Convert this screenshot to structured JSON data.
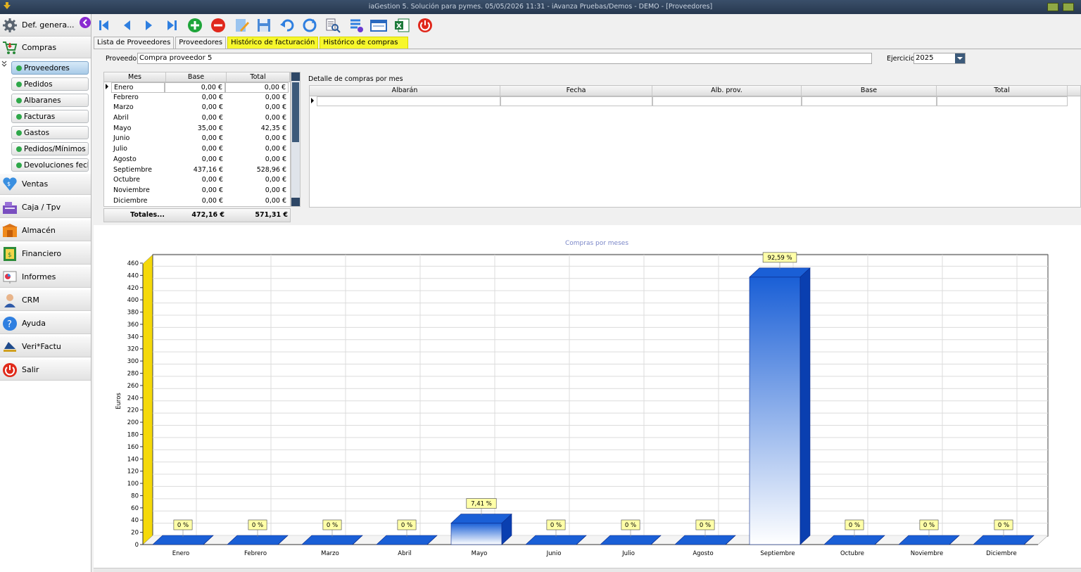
{
  "window": {
    "title": "iaGestion 5. Solución para pymes.  05/05/2026 11:31  -  iAvanza Pruebas/Demos - DEMO - [Proveedores]"
  },
  "sidebar": {
    "top_item": "Def. genera...",
    "sections": [
      {
        "label": "Compras",
        "icon": "cart-icon"
      },
      {
        "label": "Ventas",
        "icon": "sales-icon"
      },
      {
        "label": "Caja / Tpv",
        "icon": "cash-register-icon"
      },
      {
        "label": "Almacén",
        "icon": "warehouse-icon"
      },
      {
        "label": "Financiero",
        "icon": "finance-icon"
      },
      {
        "label": "Informes",
        "icon": "reports-icon"
      },
      {
        "label": "CRM",
        "icon": "crm-icon"
      },
      {
        "label": "Ayuda",
        "icon": "help-icon"
      },
      {
        "label": "Veri*Factu",
        "icon": "verifactu-icon"
      },
      {
        "label": "Salir",
        "icon": "power-icon"
      }
    ],
    "sub_items": [
      "Proveedores",
      "Pedidos",
      "Albaranes",
      "Facturas",
      "Gastos",
      "Pedidos/Mínimos",
      "Devoluciones fecha"
    ],
    "active_sub": "Proveedores"
  },
  "toolbar": {
    "buttons": [
      "first-record-icon",
      "previous-record-icon",
      "next-record-icon",
      "last-record-icon",
      "add-icon",
      "delete-icon",
      "edit-icon",
      "save-icon",
      "undo-icon",
      "refresh-icon",
      "search-icon",
      "list-icon",
      "card-icon",
      "excel-icon",
      "power-icon"
    ]
  },
  "tabs": [
    {
      "label": "Lista de Proveedores",
      "highlight": false
    },
    {
      "label": "Proveedores",
      "highlight": false
    },
    {
      "label": "Histórico de facturación",
      "highlight": true
    },
    {
      "label": "Histórico de compras",
      "highlight": true
    }
  ],
  "form": {
    "proveedor_label": "Proveedor",
    "proveedor_value": "Compra proveedor 5",
    "ejercicio_label": "Ejercicio",
    "ejercicio_value": "2025"
  },
  "month_grid": {
    "headers": [
      "Mes",
      "Base",
      "Total"
    ],
    "rows": [
      {
        "mes": "Enero",
        "base": "0,00 €",
        "total": "0,00 €"
      },
      {
        "mes": "Febrero",
        "base": "0,00 €",
        "total": "0,00 €"
      },
      {
        "mes": "Marzo",
        "base": "0,00 €",
        "total": "0,00 €"
      },
      {
        "mes": "Abril",
        "base": "0,00 €",
        "total": "0,00 €"
      },
      {
        "mes": "Mayo",
        "base": "35,00 €",
        "total": "42,35 €"
      },
      {
        "mes": "Junio",
        "base": "0,00 €",
        "total": "0,00 €"
      },
      {
        "mes": "Julio",
        "base": "0,00 €",
        "total": "0,00 €"
      },
      {
        "mes": "Agosto",
        "base": "0,00 €",
        "total": "0,00 €"
      },
      {
        "mes": "Septiembre",
        "base": "437,16 €",
        "total": "528,96 €"
      },
      {
        "mes": "Octubre",
        "base": "0,00 €",
        "total": "0,00 €"
      },
      {
        "mes": "Noviembre",
        "base": "0,00 €",
        "total": "0,00 €"
      },
      {
        "mes": "Diciembre",
        "base": "0,00 €",
        "total": "0,00 €"
      }
    ],
    "totals": {
      "label": "Totales...",
      "base": "472,16 €",
      "total": "571,31 €"
    }
  },
  "detail": {
    "title": "Detalle de compras por mes",
    "headers": [
      "Albarán",
      "Fecha",
      "Alb. prov.",
      "Base",
      "Total"
    ]
  },
  "chart_data": {
    "type": "bar",
    "title": "Compras por meses",
    "ylabel": "Euros",
    "xlabel": "",
    "ylim": [
      0,
      460
    ],
    "ytick_step": 20,
    "categories": [
      "Enero",
      "Febrero",
      "Marzo",
      "Abril",
      "Mayo",
      "Junio",
      "Julio",
      "Agosto",
      "Septiembre",
      "Octubre",
      "Noviembre",
      "Diciembre"
    ],
    "values": [
      0,
      0,
      0,
      0,
      35,
      0,
      0,
      0,
      437.16,
      0,
      0,
      0
    ],
    "data_labels": [
      "0 %",
      "0 %",
      "0 %",
      "0 %",
      "7,41 %",
      "0 %",
      "0 %",
      "0 %",
      "92,59 %",
      "0 %",
      "0 %",
      "0 %"
    ],
    "bar_color": "#1a5fd6",
    "title_color": "#7a86c8",
    "wall_color": "#f5d90a"
  }
}
